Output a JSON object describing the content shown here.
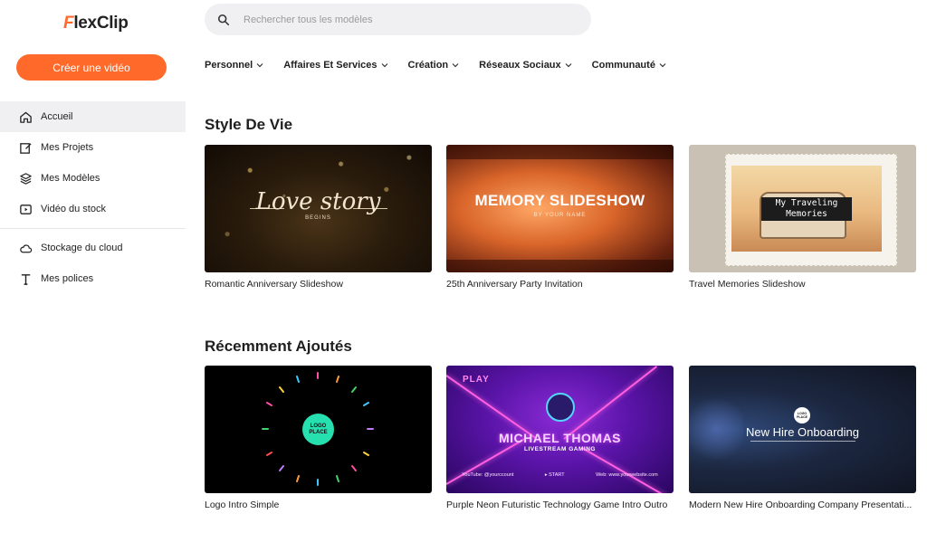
{
  "brand": {
    "name": "FlexClip",
    "accent": "#ff6a2b"
  },
  "sidebar": {
    "create_label": "Créer une vidéo",
    "items": [
      {
        "label": "Accueil",
        "icon": "home-icon",
        "active": true
      },
      {
        "label": "Mes Projets",
        "icon": "edit-icon"
      },
      {
        "label": "Mes Modèles",
        "icon": "layers-icon"
      },
      {
        "label": "Vidéo du stock",
        "icon": "video-icon"
      }
    ],
    "secondary": [
      {
        "label": "Stockage du cloud",
        "icon": "cloud-icon"
      },
      {
        "label": "Mes polices",
        "icon": "font-icon"
      }
    ]
  },
  "search": {
    "placeholder": "Rechercher tous les modèles"
  },
  "categories": [
    {
      "label": "Personnel"
    },
    {
      "label": "Affaires Et Services"
    },
    {
      "label": "Création"
    },
    {
      "label": "Réseaux Sociaux"
    },
    {
      "label": "Communauté"
    }
  ],
  "sections": [
    {
      "title": "Style De Vie",
      "cards": [
        {
          "title": "Romantic Anniversary Slideshow",
          "thumb_text": "Love story",
          "thumb_sub": "BEGINS"
        },
        {
          "title": "25th Anniversary Party Invitation",
          "thumb_text": "MEMORY SLIDESHOW",
          "thumb_sub": "BY YOUR NAME"
        },
        {
          "title": "Travel Memories Slideshow",
          "thumb_text": "My Traveling Memories"
        }
      ]
    },
    {
      "title": "Récemment Ajoutés",
      "cards": [
        {
          "title": "Logo Intro Simple",
          "thumb_text": "LOGO PLACE"
        },
        {
          "title": "Purple Neon Futuristic Technology Game Intro Outro",
          "thumb_text": "MICHAEL THOMAS",
          "thumb_sub": "LIVESTREAM GAMING",
          "thumb_play": "PLAY",
          "thumb_foot": [
            "YouTube: @yourccount",
            "▸ START",
            "Web: www.yourwebsite.com"
          ]
        },
        {
          "title": "Modern New Hire Onboarding Company Presentati...",
          "thumb_text": "New Hire Onboarding",
          "thumb_badge": "LOGO PLACE"
        }
      ]
    }
  ]
}
